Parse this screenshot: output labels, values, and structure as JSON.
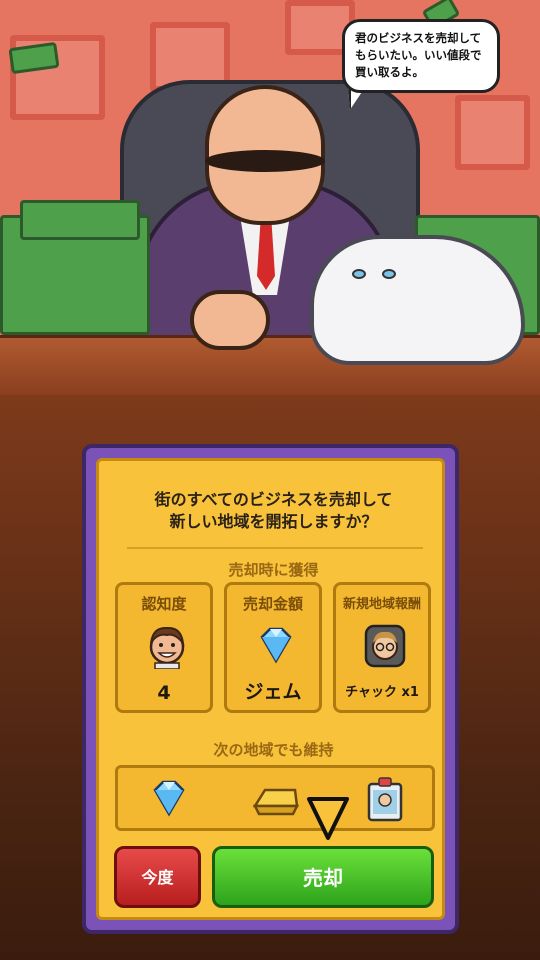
{
  "speech_bubble": {
    "text": "君のビジネスを売却してもらいたい。いい値段で買い取るよ。"
  },
  "dialog": {
    "question_line1": "街のすべてのビジネスを売却して",
    "question_line2": "新しい地域を開拓しますか？",
    "gain_label": "売却時に獲得",
    "rewards": [
      {
        "title": "認知度",
        "value": "4",
        "icon": "fan-face-icon"
      },
      {
        "title": "売却金額",
        "value": "ジェム",
        "icon": "gem-icon"
      },
      {
        "title": "新規地域報酬",
        "value": "チャック x1",
        "icon": "chuck-portrait-icon"
      }
    ],
    "keep_label": "次の地域でも維持",
    "kept_items": [
      "gem-icon",
      "gold-bar-icon",
      "id-badge-icon"
    ],
    "later_button": "今度",
    "sell_button": "売却"
  },
  "colors": {
    "dialog_border": "#7a52b8",
    "panel": "#f8c33a",
    "sell_green": "#3fbf25",
    "later_red": "#d23434"
  }
}
